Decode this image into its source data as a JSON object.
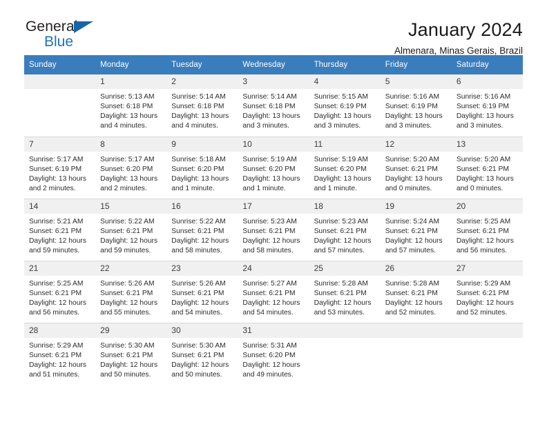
{
  "brand": {
    "name_part1": "General",
    "name_part2": "Blue"
  },
  "header": {
    "title": "January 2024",
    "subtitle": "Almenara, Minas Gerais, Brazil"
  },
  "colors": {
    "header_bar": "#3a7dbd",
    "daynum_band": "#f0f0f0",
    "brand_blue": "#1a73b8",
    "grid_line": "#d8d8d8"
  },
  "weekday_headers": [
    "Sunday",
    "Monday",
    "Tuesday",
    "Wednesday",
    "Thursday",
    "Friday",
    "Saturday"
  ],
  "labels": {
    "sunrise_prefix": "Sunrise:",
    "sunset_prefix": "Sunset:",
    "daylight_prefix": "Daylight:"
  },
  "weeks": [
    [
      {
        "day": "",
        "blank": true,
        "line1": "",
        "line2": "",
        "line3": "",
        "line4": ""
      },
      {
        "day": "1",
        "line1": "Sunrise: 5:13 AM",
        "line2": "Sunset: 6:18 PM",
        "line3": "Daylight: 13 hours",
        "line4": "and 4 minutes."
      },
      {
        "day": "2",
        "line1": "Sunrise: 5:14 AM",
        "line2": "Sunset: 6:18 PM",
        "line3": "Daylight: 13 hours",
        "line4": "and 4 minutes."
      },
      {
        "day": "3",
        "line1": "Sunrise: 5:14 AM",
        "line2": "Sunset: 6:18 PM",
        "line3": "Daylight: 13 hours",
        "line4": "and 3 minutes."
      },
      {
        "day": "4",
        "line1": "Sunrise: 5:15 AM",
        "line2": "Sunset: 6:19 PM",
        "line3": "Daylight: 13 hours",
        "line4": "and 3 minutes."
      },
      {
        "day": "5",
        "line1": "Sunrise: 5:16 AM",
        "line2": "Sunset: 6:19 PM",
        "line3": "Daylight: 13 hours",
        "line4": "and 3 minutes."
      },
      {
        "day": "6",
        "line1": "Sunrise: 5:16 AM",
        "line2": "Sunset: 6:19 PM",
        "line3": "Daylight: 13 hours",
        "line4": "and 3 minutes."
      }
    ],
    [
      {
        "day": "7",
        "line1": "Sunrise: 5:17 AM",
        "line2": "Sunset: 6:19 PM",
        "line3": "Daylight: 13 hours",
        "line4": "and 2 minutes."
      },
      {
        "day": "8",
        "line1": "Sunrise: 5:17 AM",
        "line2": "Sunset: 6:20 PM",
        "line3": "Daylight: 13 hours",
        "line4": "and 2 minutes."
      },
      {
        "day": "9",
        "line1": "Sunrise: 5:18 AM",
        "line2": "Sunset: 6:20 PM",
        "line3": "Daylight: 13 hours",
        "line4": "and 1 minute."
      },
      {
        "day": "10",
        "line1": "Sunrise: 5:19 AM",
        "line2": "Sunset: 6:20 PM",
        "line3": "Daylight: 13 hours",
        "line4": "and 1 minute."
      },
      {
        "day": "11",
        "line1": "Sunrise: 5:19 AM",
        "line2": "Sunset: 6:20 PM",
        "line3": "Daylight: 13 hours",
        "line4": "and 1 minute."
      },
      {
        "day": "12",
        "line1": "Sunrise: 5:20 AM",
        "line2": "Sunset: 6:21 PM",
        "line3": "Daylight: 13 hours",
        "line4": "and 0 minutes."
      },
      {
        "day": "13",
        "line1": "Sunrise: 5:20 AM",
        "line2": "Sunset: 6:21 PM",
        "line3": "Daylight: 13 hours",
        "line4": "and 0 minutes."
      }
    ],
    [
      {
        "day": "14",
        "line1": "Sunrise: 5:21 AM",
        "line2": "Sunset: 6:21 PM",
        "line3": "Daylight: 12 hours",
        "line4": "and 59 minutes."
      },
      {
        "day": "15",
        "line1": "Sunrise: 5:22 AM",
        "line2": "Sunset: 6:21 PM",
        "line3": "Daylight: 12 hours",
        "line4": "and 59 minutes."
      },
      {
        "day": "16",
        "line1": "Sunrise: 5:22 AM",
        "line2": "Sunset: 6:21 PM",
        "line3": "Daylight: 12 hours",
        "line4": "and 58 minutes."
      },
      {
        "day": "17",
        "line1": "Sunrise: 5:23 AM",
        "line2": "Sunset: 6:21 PM",
        "line3": "Daylight: 12 hours",
        "line4": "and 58 minutes."
      },
      {
        "day": "18",
        "line1": "Sunrise: 5:23 AM",
        "line2": "Sunset: 6:21 PM",
        "line3": "Daylight: 12 hours",
        "line4": "and 57 minutes."
      },
      {
        "day": "19",
        "line1": "Sunrise: 5:24 AM",
        "line2": "Sunset: 6:21 PM",
        "line3": "Daylight: 12 hours",
        "line4": "and 57 minutes."
      },
      {
        "day": "20",
        "line1": "Sunrise: 5:25 AM",
        "line2": "Sunset: 6:21 PM",
        "line3": "Daylight: 12 hours",
        "line4": "and 56 minutes."
      }
    ],
    [
      {
        "day": "21",
        "line1": "Sunrise: 5:25 AM",
        "line2": "Sunset: 6:21 PM",
        "line3": "Daylight: 12 hours",
        "line4": "and 56 minutes."
      },
      {
        "day": "22",
        "line1": "Sunrise: 5:26 AM",
        "line2": "Sunset: 6:21 PM",
        "line3": "Daylight: 12 hours",
        "line4": "and 55 minutes."
      },
      {
        "day": "23",
        "line1": "Sunrise: 5:26 AM",
        "line2": "Sunset: 6:21 PM",
        "line3": "Daylight: 12 hours",
        "line4": "and 54 minutes."
      },
      {
        "day": "24",
        "line1": "Sunrise: 5:27 AM",
        "line2": "Sunset: 6:21 PM",
        "line3": "Daylight: 12 hours",
        "line4": "and 54 minutes."
      },
      {
        "day": "25",
        "line1": "Sunrise: 5:28 AM",
        "line2": "Sunset: 6:21 PM",
        "line3": "Daylight: 12 hours",
        "line4": "and 53 minutes."
      },
      {
        "day": "26",
        "line1": "Sunrise: 5:28 AM",
        "line2": "Sunset: 6:21 PM",
        "line3": "Daylight: 12 hours",
        "line4": "and 52 minutes."
      },
      {
        "day": "27",
        "line1": "Sunrise: 5:29 AM",
        "line2": "Sunset: 6:21 PM",
        "line3": "Daylight: 12 hours",
        "line4": "and 52 minutes."
      }
    ],
    [
      {
        "day": "28",
        "line1": "Sunrise: 5:29 AM",
        "line2": "Sunset: 6:21 PM",
        "line3": "Daylight: 12 hours",
        "line4": "and 51 minutes."
      },
      {
        "day": "29",
        "line1": "Sunrise: 5:30 AM",
        "line2": "Sunset: 6:21 PM",
        "line3": "Daylight: 12 hours",
        "line4": "and 50 minutes."
      },
      {
        "day": "30",
        "line1": "Sunrise: 5:30 AM",
        "line2": "Sunset: 6:21 PM",
        "line3": "Daylight: 12 hours",
        "line4": "and 50 minutes."
      },
      {
        "day": "31",
        "line1": "Sunrise: 5:31 AM",
        "line2": "Sunset: 6:20 PM",
        "line3": "Daylight: 12 hours",
        "line4": "and 49 minutes."
      },
      {
        "day": "",
        "blank": true,
        "line1": "",
        "line2": "",
        "line3": "",
        "line4": ""
      },
      {
        "day": "",
        "blank": true,
        "line1": "",
        "line2": "",
        "line3": "",
        "line4": ""
      },
      {
        "day": "",
        "blank": true,
        "line1": "",
        "line2": "",
        "line3": "",
        "line4": ""
      }
    ]
  ]
}
